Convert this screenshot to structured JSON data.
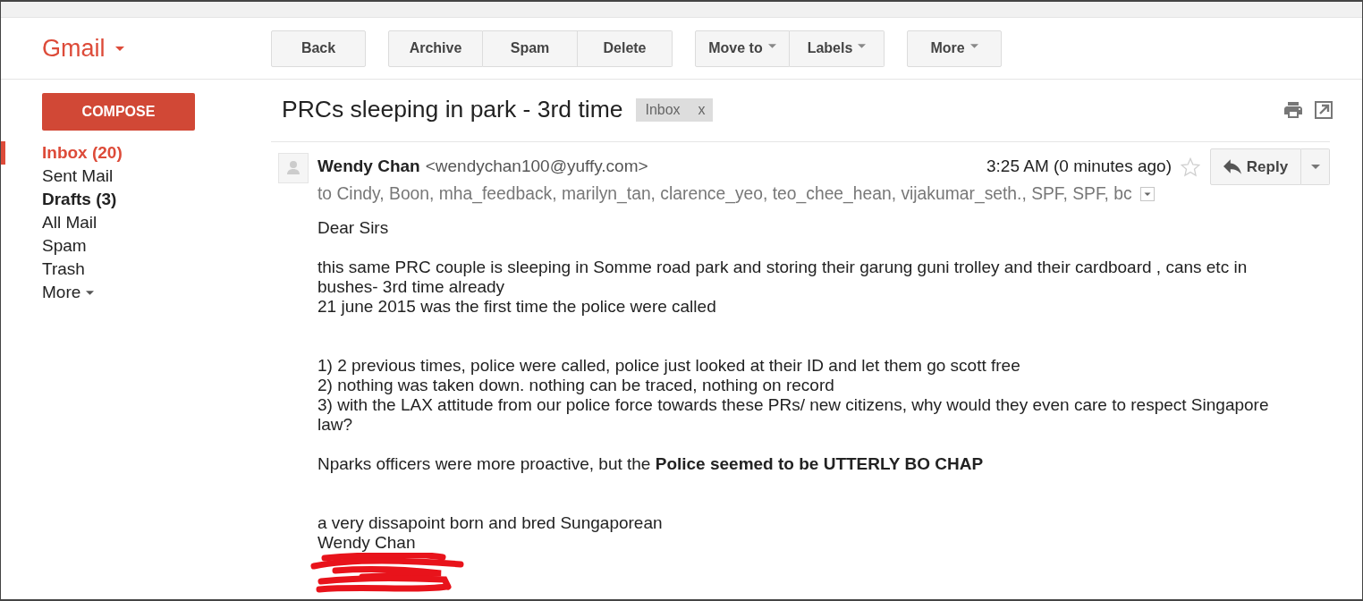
{
  "app": {
    "logo": "Gmail"
  },
  "toolbar": [
    {
      "buttons": [
        {
          "label": "Back",
          "dropdown": false
        }
      ]
    },
    {
      "buttons": [
        {
          "label": "Archive",
          "dropdown": false
        },
        {
          "label": "Spam",
          "dropdown": false
        },
        {
          "label": "Delete",
          "dropdown": false
        }
      ]
    },
    {
      "buttons": [
        {
          "label": "Move to",
          "dropdown": true
        },
        {
          "label": "Labels",
          "dropdown": true
        }
      ]
    },
    {
      "buttons": [
        {
          "label": "More",
          "dropdown": true
        }
      ]
    }
  ],
  "sidebar": {
    "compose": "COMPOSE",
    "items": [
      {
        "label": "Inbox (20)",
        "selected": true,
        "unread": true,
        "dropdown": false
      },
      {
        "label": "Sent Mail",
        "selected": false,
        "unread": false,
        "dropdown": false
      },
      {
        "label": "Drafts (3)",
        "selected": false,
        "unread": true,
        "dropdown": false
      },
      {
        "label": "All Mail",
        "selected": false,
        "unread": false,
        "dropdown": false
      },
      {
        "label": "Spam",
        "selected": false,
        "unread": false,
        "dropdown": false
      },
      {
        "label": "Trash",
        "selected": false,
        "unread": false,
        "dropdown": false
      },
      {
        "label": "More",
        "selected": false,
        "unread": false,
        "dropdown": true
      }
    ]
  },
  "thread": {
    "subject": "PRCs sleeping in park - 3rd time",
    "labels": [
      {
        "label": "Inbox",
        "remove": "x"
      }
    ]
  },
  "message": {
    "sender_name": "Wendy Chan",
    "sender_email": "<wendychan100@yuffy.com>",
    "time": "3:25 AM (0 minutes ago)",
    "starred": false,
    "reply": "Reply",
    "recipients": "to Cindy, Boon, mha_feedback, marilyn_tan, clarence_yeo, teo_chee_hean, vijakumar_seth., SPF, SPF, bc",
    "body": [
      {
        "kind": "greeting",
        "lines": [
          "Dear Sirs"
        ]
      },
      {
        "kind": "paragraph",
        "lines": [
          "this same PRC couple is sleeping in Somme road park and storing their garung guni trolley and their cardboard , cans etc in bushes- 3rd time already",
          "21 june 2015 was the first time the police were called"
        ]
      },
      {
        "kind": "list",
        "lines": [
          "1) 2 previous times, police were called, police just looked at their ID and let them go scott free",
          "2) nothing was taken down. nothing can be traced, nothing on record",
          "3) with the LAX attitude from our police force towards these PRs/ new citizens, why would they even care to respect Singapore law?"
        ]
      },
      {
        "kind": "paragraph",
        "lines": [
          "Nparks officers were more proactive, but the **Police seemed to be UTTERLY BO CHAP**"
        ]
      },
      {
        "kind": "signature",
        "redacted": true,
        "lines": [
          "a very dissapoint born and bred Sungaporean",
          "Wendy Chan"
        ]
      }
    ]
  }
}
